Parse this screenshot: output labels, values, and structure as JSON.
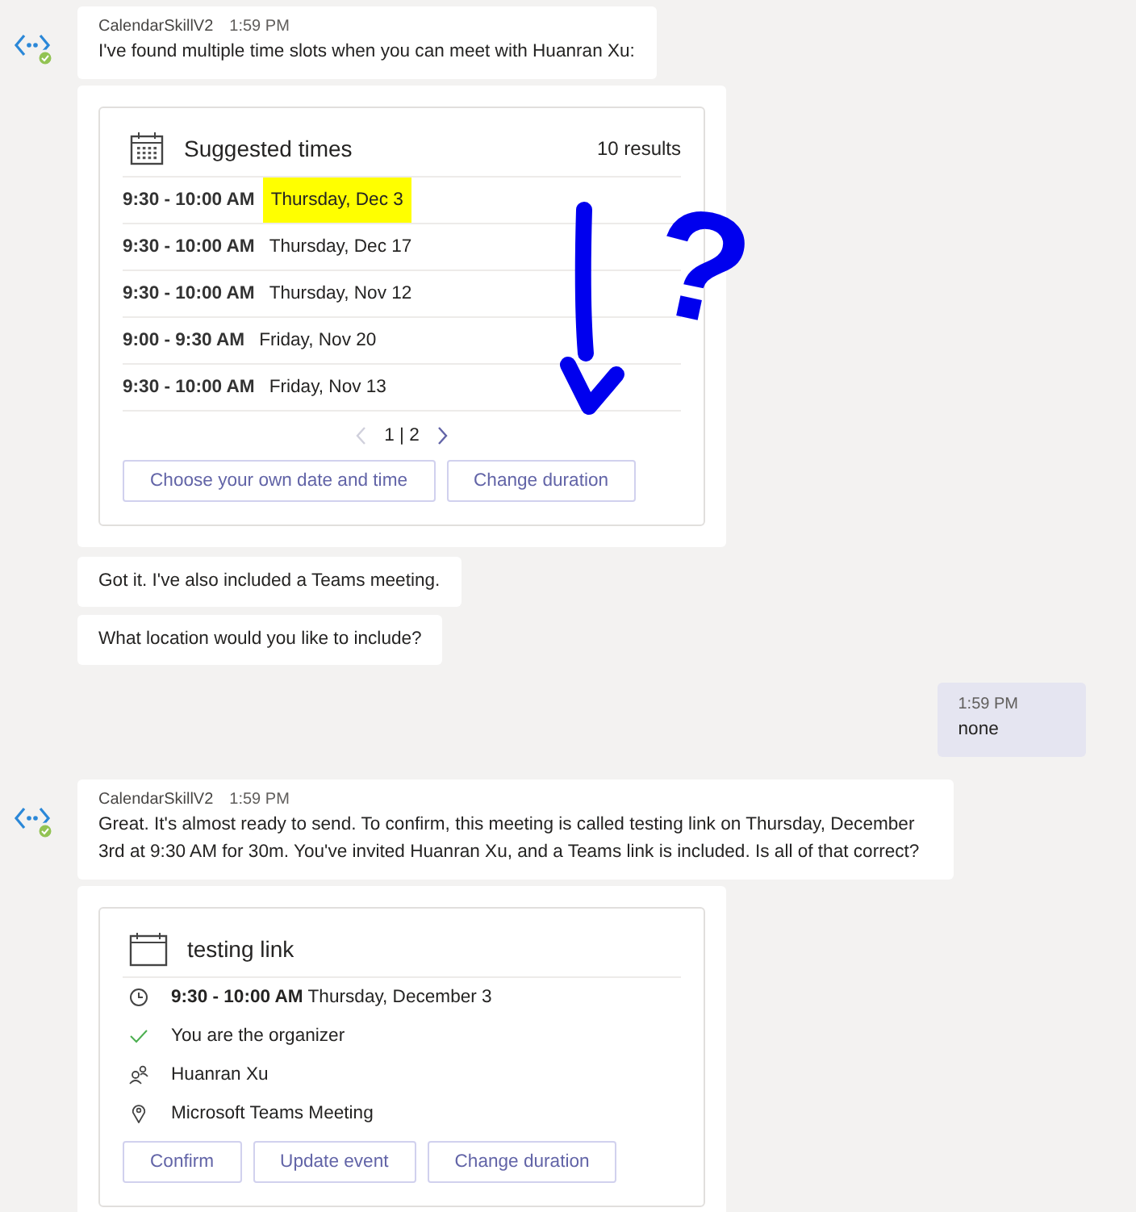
{
  "first_message": {
    "sender": "CalendarSkillV2",
    "time": "1:59 PM",
    "text": "I've found multiple time slots when you can meet with Huanran Xu:"
  },
  "suggestions_card": {
    "title": "Suggested times",
    "count": "10 results",
    "slots": [
      {
        "time": "9:30 - 10:00 AM",
        "date": "Thursday, Dec 3",
        "highlighted": true
      },
      {
        "time": "9:30 - 10:00 AM",
        "date": "Thursday, Dec 17",
        "highlighted": false
      },
      {
        "time": "9:30 - 10:00 AM",
        "date": "Thursday, Nov 12",
        "highlighted": false
      },
      {
        "time": "9:00 - 9:30 AM",
        "date": "Friday, Nov 20",
        "highlighted": false
      },
      {
        "time": "9:30 - 10:00 AM",
        "date": "Friday, Nov 13",
        "highlighted": false
      }
    ],
    "pager": {
      "page": "1 | 2",
      "prev_disabled": true,
      "next_disabled": false
    },
    "buttons": [
      "Choose your own date and time",
      "Change duration"
    ]
  },
  "follow_ups": [
    "Got it. I've also included a Teams meeting.",
    "What location would you like to include?"
  ],
  "user_message": {
    "time": "1:59 PM",
    "text": "none"
  },
  "second_message": {
    "sender": "CalendarSkillV2",
    "time": "1:59 PM",
    "text": "Great. It's almost ready to send. To confirm, this meeting is called testing link on Thursday, December 3rd at 9:30 AM for 30m. You've invited Huanran Xu, and a Teams link is included. Is all of that correct?"
  },
  "event_card": {
    "title": "testing link",
    "details": [
      {
        "kind": "time",
        "text": "**9:30 - 10:00 AM** Thursday, December 3"
      },
      {
        "kind": "organizer",
        "text": "You are the organizer"
      },
      {
        "kind": "attendee",
        "text": "Huanran Xu"
      },
      {
        "kind": "location",
        "text": "Microsoft Teams Meeting"
      }
    ],
    "buttons": [
      "Confirm",
      "Update event",
      "Change duration"
    ]
  },
  "annotation": {
    "mark": "?"
  }
}
